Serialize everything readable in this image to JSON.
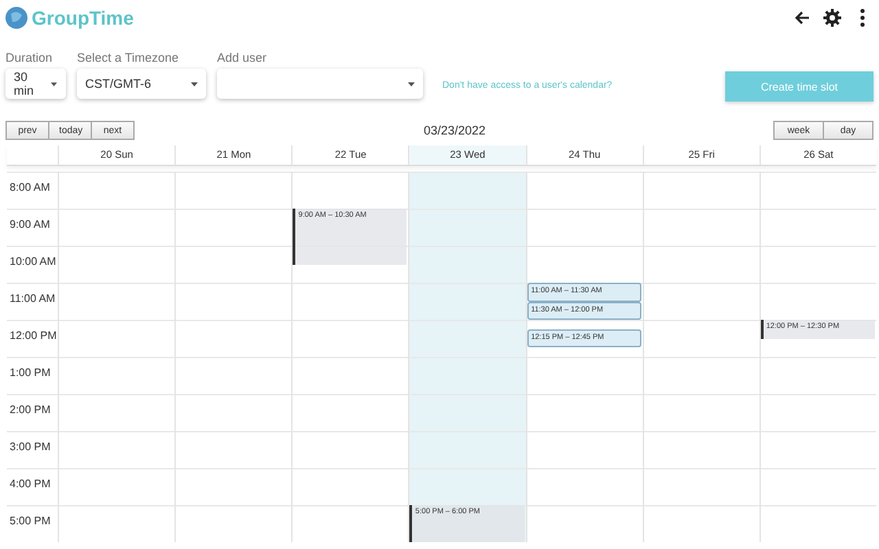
{
  "app": {
    "title": "GroupTime"
  },
  "controls": {
    "duration": {
      "label": "Duration",
      "value": "30 min"
    },
    "timezone": {
      "label": "Select a Timezone",
      "value": "CST/GMT-6"
    },
    "add_user": {
      "label": "Add user"
    },
    "link": "Don't have access to a user's calendar?",
    "create_button": "Create time slot"
  },
  "toolbar": {
    "nav": [
      "prev",
      "today",
      "next"
    ],
    "date": "03/23/2022",
    "views": [
      "week",
      "day"
    ]
  },
  "times": [
    "8:00 AM",
    "9:00 AM",
    "10:00 AM",
    "11:00 AM",
    "12:00 PM",
    "1:00 PM",
    "2:00 PM",
    "3:00 PM",
    "4:00 PM",
    "5:00 PM"
  ],
  "days": [
    {
      "label": "20 Sun",
      "today": false
    },
    {
      "label": "21 Mon",
      "today": false
    },
    {
      "label": "22 Tue",
      "today": false,
      "events": [
        {
          "kind": "busy",
          "label": "9:00 AM – 10:30 AM"
        }
      ]
    },
    {
      "label": "23 Wed",
      "today": true,
      "events": [
        {
          "kind": "busy",
          "label": "5:00 PM – 6:00 PM"
        }
      ]
    },
    {
      "label": "24 Thu",
      "today": false,
      "events": [
        {
          "kind": "slot",
          "label": "11:00 AM – 11:30 AM"
        },
        {
          "kind": "slot",
          "label": "11:30 AM – 12:00 PM"
        },
        {
          "kind": "slot",
          "label": "12:15 PM – 12:45 PM"
        }
      ]
    },
    {
      "label": "25 Fri",
      "today": false
    },
    {
      "label": "26 Sat",
      "today": false,
      "events": [
        {
          "kind": "busy",
          "label": "12:00 PM – 12:30 PM"
        }
      ]
    }
  ]
}
